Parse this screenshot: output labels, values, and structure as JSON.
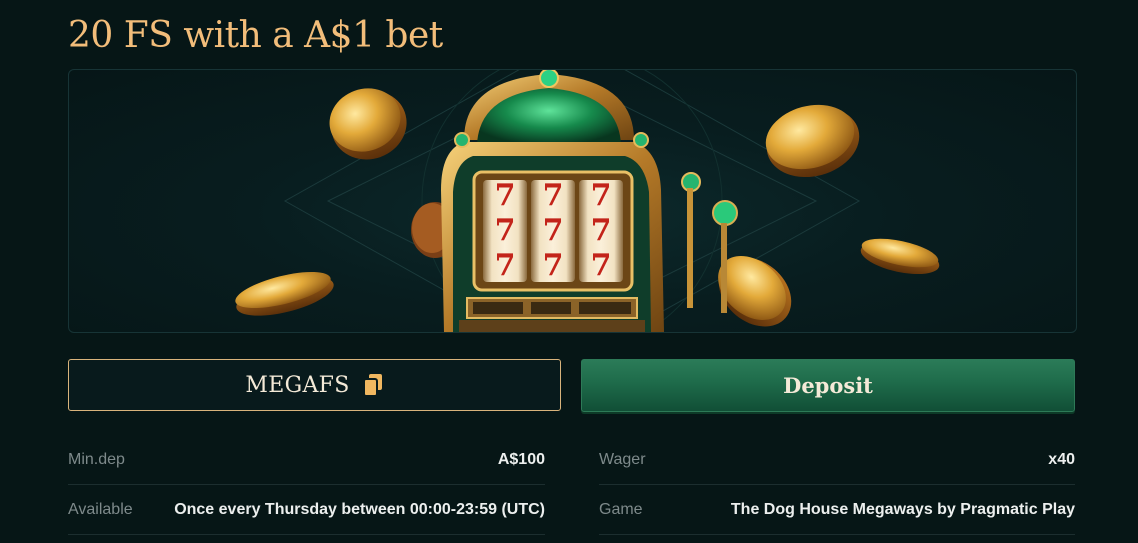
{
  "offer": {
    "title": "20 FS with a A$1 bet"
  },
  "banner": {
    "image": "slot-machine-with-gold-coins",
    "reels": [
      "7",
      "7",
      "7"
    ]
  },
  "promo": {
    "code": "MEGAFS",
    "copy_icon": "copy-icon"
  },
  "actions": {
    "deposit_label": "Deposit"
  },
  "details": {
    "min_dep_label": "Min.dep",
    "min_dep_value": "A$100",
    "wager_label": "Wager",
    "wager_value": "x40",
    "available_label": "Available",
    "available_value": "Once every Thursday between 00:00-23:59 (UTC)",
    "game_label": "Game",
    "game_value": "The Dog House Megaways by Pragmatic Play"
  },
  "colors": {
    "background": "#061616",
    "title_gold": "#f2bd7a",
    "button_border_gold": "#d9b47c",
    "deposit_green": "#1e6b4a"
  }
}
